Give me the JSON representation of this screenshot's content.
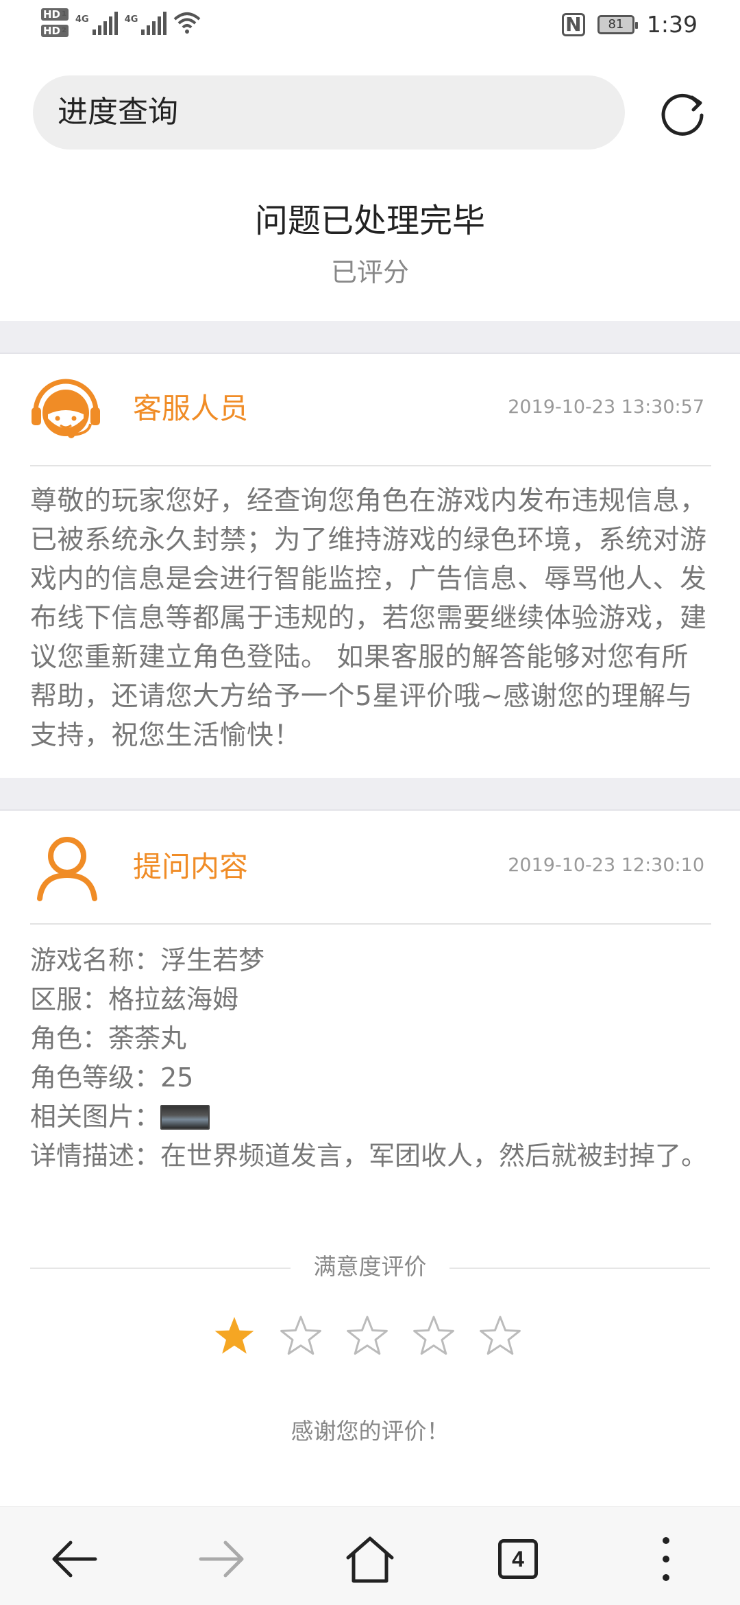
{
  "status_bar": {
    "hd1": "HD",
    "hd1_sub": "1",
    "hd2": "HD",
    "hd2_sub": "2",
    "net1": "4G",
    "net2": "4G",
    "battery": "81",
    "time": "1:39"
  },
  "search": {
    "value": "进度查询"
  },
  "header": {
    "title": "问题已处理完毕",
    "status": "已评分"
  },
  "reply": {
    "label": "客服人员",
    "timestamp": "2019-10-23 13:30:57",
    "text": "尊敬的玩家您好，经查询您角色在游戏内发布违规信息，已被系统永久封禁；为了维持游戏的绿色环境，系统对游戏内的信息是会进行智能监控，广告信息、辱骂他人、发布线下信息等都属于违规的，若您需要继续体验游戏，建议您重新建立角色登陆。 如果客服的解答能够对您有所帮助，还请您大方给予一个5星评价哦~感谢您的理解与支持，祝您生活愉快！"
  },
  "question": {
    "label": "提问内容",
    "timestamp": "2019-10-23 12:30:10",
    "game_name": "游戏名称：浮生若梦",
    "server": "区服：格拉兹海姆",
    "role": "角色：荼荼丸",
    "role_level": "角色等级：25",
    "image_label": "相关图片：",
    "description": "详情描述：在世界频道发言，军团收人，然后就被封掉了。"
  },
  "rating": {
    "label": "满意度评价",
    "stars": 1,
    "max_stars": 5,
    "thanks": "感谢您的评价！"
  },
  "bottom_nav": {
    "tab_count": "4"
  },
  "colors": {
    "accent": "#f08c26",
    "star_filled": "#f5a623",
    "star_empty": "#bbbbbb",
    "separator": "#eeeef2"
  }
}
